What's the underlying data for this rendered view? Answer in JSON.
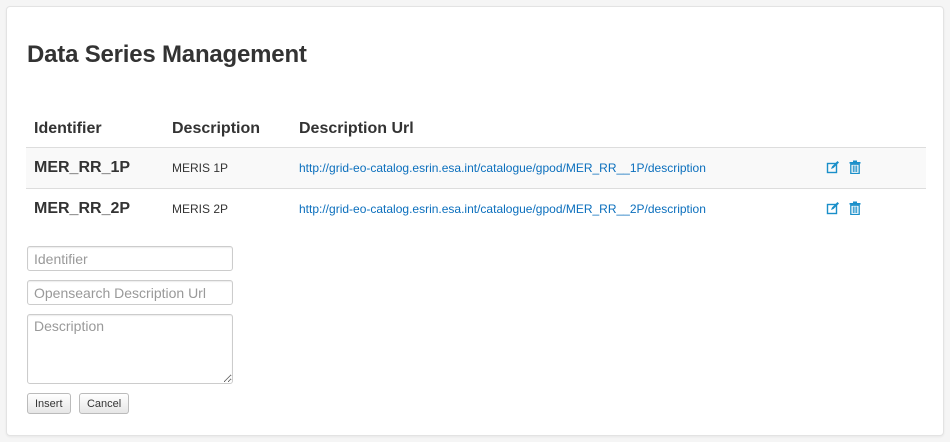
{
  "page": {
    "title": "Data Series Management"
  },
  "table": {
    "headers": [
      "Identifier",
      "Description",
      "Description Url"
    ],
    "rows": [
      {
        "identifier": "MER_RR_1P",
        "description": "MERIS 1P",
        "url": "http://grid-eo-catalog.esrin.esa.int/catalogue/gpod/MER_RR__1P/description"
      },
      {
        "identifier": "MER_RR_2P",
        "description": "MERIS 2P",
        "url": "http://grid-eo-catalog.esrin.esa.int/catalogue/gpod/MER_RR__2P/description"
      }
    ],
    "actions": {
      "edit_icon": "edit-icon",
      "delete_icon": "trash-icon"
    }
  },
  "form": {
    "identifier_placeholder": "Identifier",
    "url_placeholder": "Opensearch Description Url",
    "description_placeholder": "Description",
    "insert_label": "Insert",
    "cancel_label": "Cancel"
  },
  "colors": {
    "link": "#0b6fbd",
    "icon": "#1a8fc9"
  }
}
